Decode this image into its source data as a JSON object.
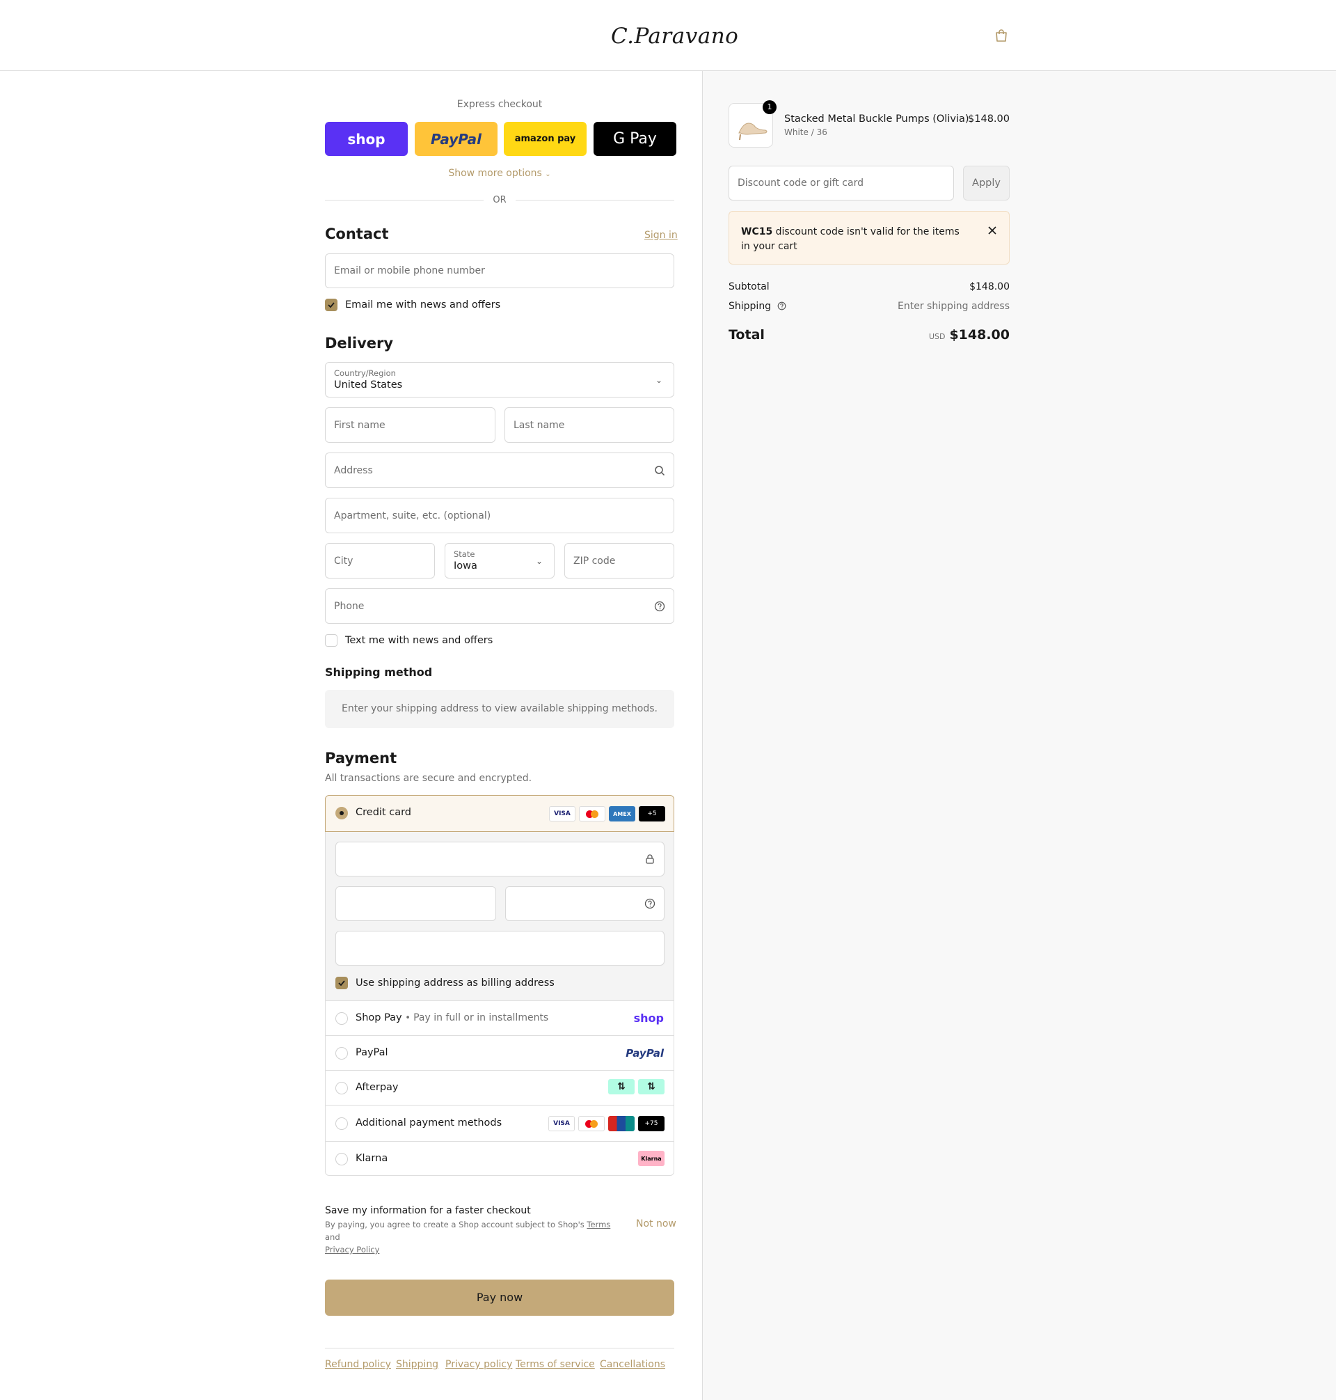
{
  "brand": {
    "logo": "C.Paravano",
    "accent": "#c4a979"
  },
  "express": {
    "title": "Express checkout",
    "buttons": [
      {
        "label": "shop",
        "color": "#5a31f4"
      },
      {
        "label": "PayPal",
        "color": "#ffc439"
      },
      {
        "label": "amazon pay",
        "color": "#ffd814"
      },
      {
        "label": "G Pay",
        "color": "#000000"
      }
    ],
    "more": "Show more options",
    "or": "OR"
  },
  "contact": {
    "title": "Contact",
    "signin": "Sign in",
    "email_placeholder": "Email or mobile phone number",
    "news_label": "Email me with news and offers"
  },
  "delivery": {
    "title": "Delivery",
    "country_label": "Country/Region",
    "country_value": "United States",
    "first_name": "First name",
    "last_name": "Last name",
    "address": "Address",
    "apartment": "Apartment, suite, etc. (optional)",
    "city": "City",
    "state_label": "State",
    "state_value": "Iowa",
    "zip": "ZIP code",
    "phone": "Phone",
    "text_label": "Text me with news and offers"
  },
  "shipping_method": {
    "title": "Shipping method",
    "info": "Enter your shipping address to view available shipping methods."
  },
  "payment": {
    "title": "Payment",
    "subtitle": "All transactions are secure and encrypted.",
    "credit_card": "Credit card",
    "card_more": "+5",
    "billing_label": "Use shipping address as billing address",
    "shop_pay": "Shop Pay",
    "shop_pay_sub": "Pay in full or in installments",
    "shop_logo": "shop",
    "paypal": "PayPal",
    "afterpay": "Afterpay",
    "additional": "Additional payment methods",
    "additional_more": "+75",
    "klarna": "Klarna",
    "klarna_logo": "Klarna"
  },
  "save": {
    "title": "Save my information for a faster checkout",
    "text_1": "By paying, you agree to create a Shop account subject to Shop's",
    "terms": "Terms",
    "and": "and",
    "privacy": "Privacy Policy",
    "not_now": "Not now"
  },
  "pay_button": "Pay now",
  "footer": [
    "Refund policy",
    "Shipping",
    "Privacy policy",
    "Terms of service",
    "Cancellations"
  ],
  "summary": {
    "product_name": "Stacked Metal Buckle Pumps (Olivia)",
    "product_variant": "White / 36",
    "product_price": "$148.00",
    "quantity": "1",
    "discount_placeholder": "Discount code or gift card",
    "apply": "Apply",
    "error_code": "WC15",
    "error_text": "discount code isn't valid for the items in your cart",
    "subtotal_label": "Subtotal",
    "subtotal_value": "$148.00",
    "shipping_label": "Shipping",
    "shipping_value": "Enter shipping address",
    "total_label": "Total",
    "total_currency": "USD",
    "total_value": "$148.00"
  }
}
